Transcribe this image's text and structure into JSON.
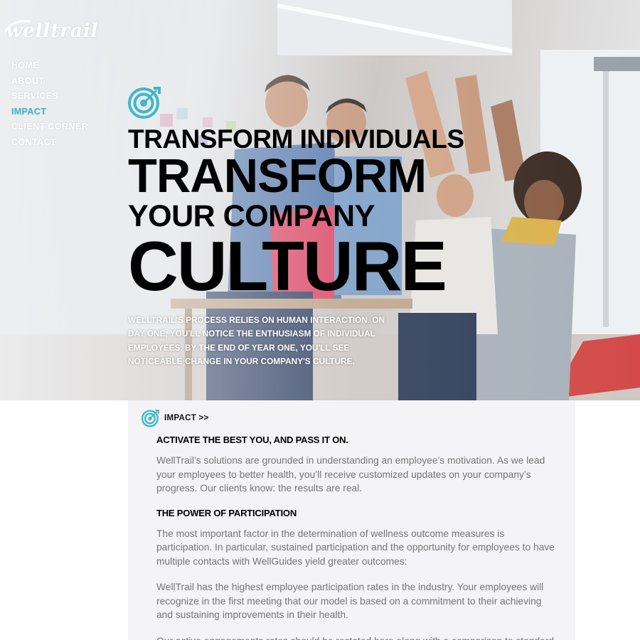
{
  "brand": {
    "logo_text": "welltrail",
    "accent_color": "#3fb8c9"
  },
  "nav": {
    "items": [
      {
        "label": "HOME"
      },
      {
        "label": "ABOUT"
      },
      {
        "label": "SERVICES"
      },
      {
        "label": "IMPACT",
        "active": true
      },
      {
        "label": "CLIENT CORNER"
      },
      {
        "label": "CONTACT"
      }
    ]
  },
  "hero": {
    "icon": "target-icon",
    "headline": [
      "TRANSFORM INDIVIDUALS",
      "TRANSFORM",
      "YOUR COMPANY",
      "CULTURE"
    ],
    "body": "WELLTRAIL'S PROCESS RELIES ON HUMAN INTERACTION. ON DAY ONE, YOU'LL NOTICE THE ENTHUSIASM OF INDIVIDUAL EMPLOYEES. BY THE END OF YEAR ONE, YOU'LL SEE NOTICEABLE CHANGE IN YOUR COMPANY'S CULTURE."
  },
  "section": {
    "icon": "target-icon",
    "label": "IMPACT >>",
    "heading_1": "ACTIVATE THE BEST YOU, AND PASS IT ON.",
    "para_1": "WellTrail’s solutions are grounded in understanding an employee’s motivation. As we lead your employees to better health, you’ll receive customized updates on your company’s progress. Our clients know: the results are real.",
    "heading_2": "THE POWER OF PARTICIPATION",
    "para_2": "The most important factor in the determination of wellness outcome measures is participation. In particular, sustained participation and the opportunity for employees to have multiple contacts with WellGuides yield greater outcomes:",
    "para_3": "WellTrail has the highest employee participation rates in the industry. Your employees will recognize in the first meeting that our model is based on a commitment to their achieving and sustaining improvements in their health.",
    "para_4": "Our active engagements rates should be restated here along with a comparison to standard"
  }
}
